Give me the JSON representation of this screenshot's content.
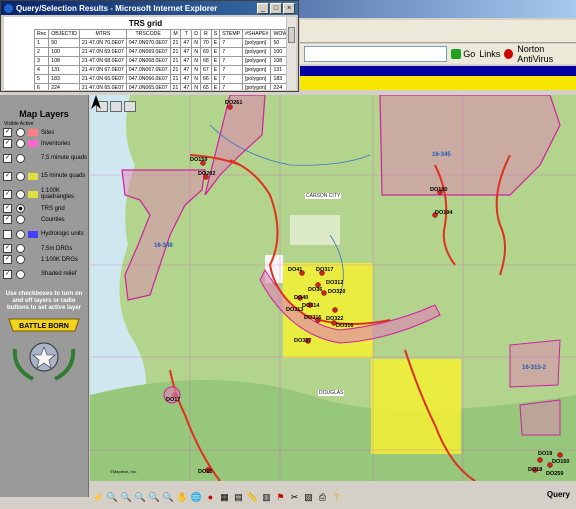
{
  "query_window": {
    "title": "Query/Selection Results - Microsoft Internet Explorer",
    "table_title": "TRS grid",
    "columns": [
      "Rec",
      "OBJECTID",
      "MTRS",
      "TRSCODE",
      "M",
      "T",
      "D",
      "R",
      "S",
      "STEMP",
      "#SHAPE#",
      "WOW"
    ],
    "rows": [
      [
        "1",
        "50",
        "21 47.0N 70.0E07",
        "047.0N070.0E07",
        "21",
        "47",
        "N",
        "70",
        "E",
        "7",
        "[polygon]",
        "50"
      ],
      [
        "2",
        "100",
        "21 47.0N 69.0E07",
        "047.0N069.0E07",
        "21",
        "47",
        "N",
        "69",
        "E",
        "7",
        "[polygon]",
        "100"
      ],
      [
        "3",
        "108",
        "21 47.0N 68.0E07",
        "047.0N068.0E07",
        "21",
        "47",
        "N",
        "68",
        "E",
        "7",
        "[polygon]",
        "108"
      ],
      [
        "4",
        "131",
        "21 47.0N 67.0E07",
        "047.0N067.0E07",
        "21",
        "47",
        "N",
        "67",
        "E",
        "7",
        "[polygon]",
        "131"
      ],
      [
        "5",
        "183",
        "21 47.0N 66.0E07",
        "047.0N066.0E07",
        "21",
        "47",
        "N",
        "66",
        "E",
        "7",
        "[polygon]",
        "183"
      ],
      [
        "6",
        "224",
        "21 47.0N 65.0E07",
        "047.0N065.0E07",
        "21",
        "47",
        "N",
        "65",
        "E",
        "7",
        "[polygon]",
        "224"
      ]
    ]
  },
  "browser": {
    "go_label": "Go",
    "links_label": "Links",
    "antivirus_label": "Norton AntiVirus"
  },
  "layers_panel": {
    "title": "Map Layers",
    "subheader": "Visible Active",
    "layers": [
      {
        "label": "Sites",
        "visible": true,
        "active": false,
        "swatch": "#ff8080"
      },
      {
        "label": "Inventories",
        "visible": true,
        "active": false,
        "swatch": "#ff66cc"
      },
      {
        "label": "7.5 minute quads",
        "visible": true,
        "active": false,
        "swatch": ""
      },
      {
        "label": "15 minute quads",
        "visible": true,
        "active": false,
        "swatch": "#e0e040"
      },
      {
        "label": "1:100K quadrangles",
        "visible": true,
        "active": false,
        "swatch": "#e0e040"
      },
      {
        "label": "TRS grid",
        "visible": true,
        "active": true,
        "swatch": ""
      },
      {
        "label": "Counties",
        "visible": true,
        "active": false,
        "swatch": ""
      },
      {
        "label": "Hydrologic units",
        "visible": false,
        "active": false,
        "swatch": "#4040ff"
      },
      {
        "label": "7.5m DRGs",
        "visible": true,
        "active": false,
        "swatch": ""
      },
      {
        "label": "1:100K DRGs",
        "visible": true,
        "active": false,
        "swatch": ""
      },
      {
        "label": "Shaded relief",
        "visible": true,
        "active": false,
        "swatch": ""
      }
    ],
    "instructions": "Use checkboxes to turn on and off layers or radio buttons to set active layer",
    "seal_text": "BATTLE BORN"
  },
  "map": {
    "place_labels": [
      "CARSON CITY",
      "DOUGLAS"
    ],
    "site_labels": [
      "DO261",
      "DO159",
      "DO202",
      "DO41",
      "DO317",
      "DO312",
      "DO320",
      "DO40",
      "DO36",
      "DO313",
      "DO314",
      "DO315",
      "DO316",
      "DO322",
      "DO357",
      "DO190",
      "DO194",
      "DO17",
      "DO15",
      "DO19",
      "DO18",
      "DO259",
      "DO150"
    ],
    "trs_labels": [
      "16-348",
      "16-345",
      "16-315-2"
    ],
    "copyright": "©Maptech, Inc."
  },
  "toolbar": {
    "mode_label": "Query"
  }
}
